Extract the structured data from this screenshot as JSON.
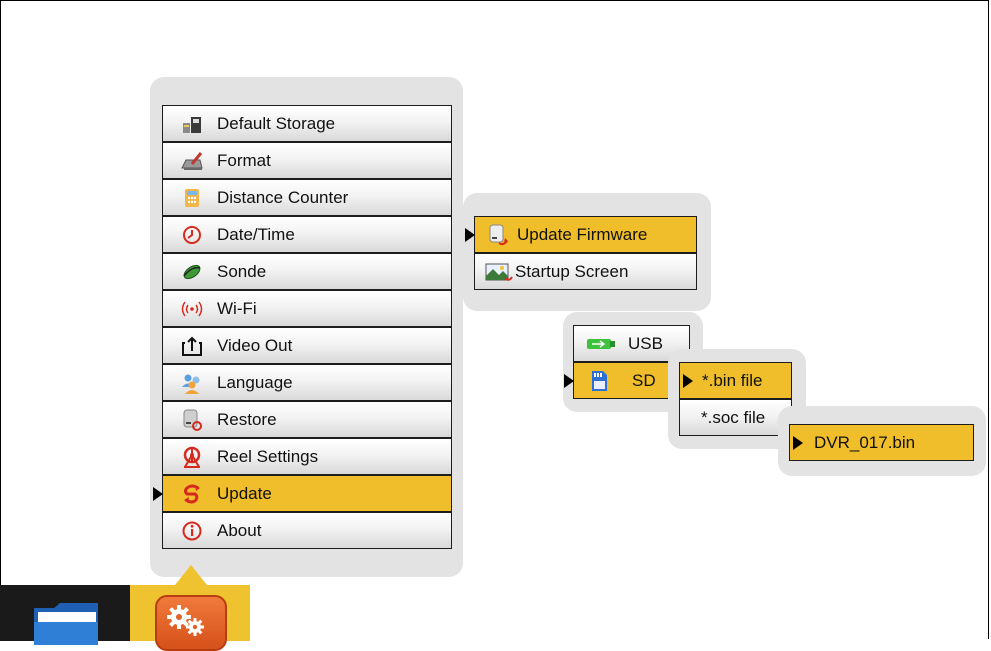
{
  "main_menu": {
    "items": [
      {
        "label": "Default Storage",
        "icon": "storage-icon"
      },
      {
        "label": "Format",
        "icon": "format-icon"
      },
      {
        "label": "Distance Counter",
        "icon": "calculator-icon"
      },
      {
        "label": "Date/Time",
        "icon": "clock-icon"
      },
      {
        "label": "Sonde",
        "icon": "sonde-icon"
      },
      {
        "label": "Wi-Fi",
        "icon": "wifi-icon"
      },
      {
        "label": "Video Out",
        "icon": "video-out-icon"
      },
      {
        "label": "Language",
        "icon": "language-icon"
      },
      {
        "label": "Restore",
        "icon": "restore-icon"
      },
      {
        "label": "Reel Settings",
        "icon": "reel-icon"
      },
      {
        "label": "Update",
        "icon": "update-icon",
        "selected": true
      },
      {
        "label": "About",
        "icon": "info-icon"
      }
    ]
  },
  "update_menu": {
    "items": [
      {
        "label": "Update Firmware",
        "icon": "update-firmware-icon",
        "selected": true
      },
      {
        "label": "Startup Screen",
        "icon": "startup-screen-icon"
      }
    ]
  },
  "source_menu": {
    "items": [
      {
        "label": "USB",
        "icon": "usb-icon"
      },
      {
        "label": "SD",
        "icon": "sd-card-icon",
        "selected": true
      }
    ]
  },
  "filetype_menu": {
    "items": [
      {
        "label": "*.bin file",
        "selected": true
      },
      {
        "label": "*.soc file"
      }
    ]
  },
  "file_menu": {
    "items": [
      {
        "label": "DVR_017.bin",
        "selected": true
      }
    ]
  },
  "taskbar": {
    "apps": [
      {
        "icon": "folder-icon"
      },
      {
        "icon": "settings-gears-icon",
        "active": true
      }
    ]
  },
  "colors": {
    "selection": "#f0be2a",
    "panel": "#e3e3e3",
    "accent_orange": "#e0602a"
  }
}
